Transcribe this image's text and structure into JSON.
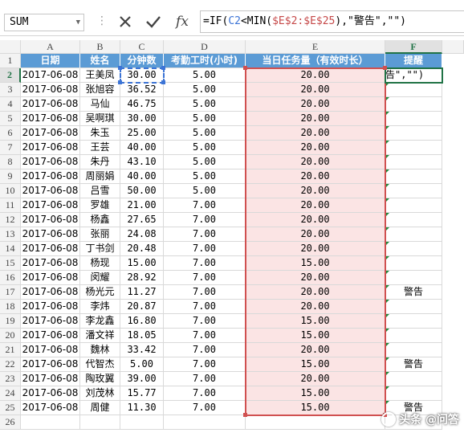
{
  "formula_bar": {
    "name_box": "SUM",
    "cancel_icon": "close-icon",
    "enter_icon": "check-icon",
    "function_icon": "fx-icon",
    "fx_label": "fx",
    "formula_parts": [
      "=IF(",
      "C2",
      "<MIN(",
      "$E$2:$E$25",
      "),\"警告\",\"\")"
    ]
  },
  "columns": [
    "A",
    "B",
    "C",
    "D",
    "E",
    "F"
  ],
  "selected_column": "F",
  "selected_row": 2,
  "headers": [
    "日期",
    "姓名",
    "分钟数",
    "考勤工时(小时)",
    "当日任务量（有效时长）",
    "提醒"
  ],
  "rows": [
    {
      "num": "2",
      "date": "2017-06-08",
      "name": "王美凤",
      "minutes": "30.00",
      "hours": "5.00",
      "task": "20.00",
      "alert": "告\",\"\")"
    },
    {
      "num": "3",
      "date": "2017-06-08",
      "name": "张旭容",
      "minutes": "36.52",
      "hours": "5.00",
      "task": "20.00",
      "alert": ""
    },
    {
      "num": "4",
      "date": "2017-06-08",
      "name": "马仙",
      "minutes": "46.75",
      "hours": "5.00",
      "task": "20.00",
      "alert": ""
    },
    {
      "num": "5",
      "date": "2017-06-08",
      "name": "吴啊琪",
      "minutes": "30.00",
      "hours": "5.00",
      "task": "20.00",
      "alert": ""
    },
    {
      "num": "6",
      "date": "2017-06-08",
      "name": "朱玉",
      "minutes": "25.00",
      "hours": "5.00",
      "task": "20.00",
      "alert": ""
    },
    {
      "num": "7",
      "date": "2017-06-08",
      "name": "王芸",
      "minutes": "40.00",
      "hours": "5.00",
      "task": "20.00",
      "alert": ""
    },
    {
      "num": "8",
      "date": "2017-06-08",
      "name": "朱丹",
      "minutes": "43.10",
      "hours": "5.00",
      "task": "20.00",
      "alert": ""
    },
    {
      "num": "9",
      "date": "2017-06-08",
      "name": "周丽娟",
      "minutes": "40.00",
      "hours": "5.00",
      "task": "20.00",
      "alert": ""
    },
    {
      "num": "10",
      "date": "2017-06-08",
      "name": "吕雪",
      "minutes": "50.00",
      "hours": "5.00",
      "task": "20.00",
      "alert": ""
    },
    {
      "num": "11",
      "date": "2017-06-08",
      "name": "罗雄",
      "minutes": "21.00",
      "hours": "7.00",
      "task": "20.00",
      "alert": ""
    },
    {
      "num": "12",
      "date": "2017-06-08",
      "name": "杨鑫",
      "minutes": "27.65",
      "hours": "7.00",
      "task": "20.00",
      "alert": ""
    },
    {
      "num": "13",
      "date": "2017-06-08",
      "name": "张丽",
      "minutes": "24.08",
      "hours": "7.00",
      "task": "20.00",
      "alert": ""
    },
    {
      "num": "14",
      "date": "2017-06-08",
      "name": "丁书剑",
      "minutes": "20.48",
      "hours": "7.00",
      "task": "20.00",
      "alert": ""
    },
    {
      "num": "15",
      "date": "2017-06-08",
      "name": "杨现",
      "minutes": "15.00",
      "hours": "7.00",
      "task": "15.00",
      "alert": ""
    },
    {
      "num": "16",
      "date": "2017-06-08",
      "name": "闵耀",
      "minutes": "28.92",
      "hours": "7.00",
      "task": "20.00",
      "alert": ""
    },
    {
      "num": "17",
      "date": "2017-06-08",
      "name": "杨光元",
      "minutes": "11.27",
      "hours": "7.00",
      "task": "20.00",
      "alert": "警告"
    },
    {
      "num": "18",
      "date": "2017-06-08",
      "name": "李炜",
      "minutes": "20.87",
      "hours": "7.00",
      "task": "20.00",
      "alert": ""
    },
    {
      "num": "19",
      "date": "2017-06-08",
      "name": "李龙鑫",
      "minutes": "16.80",
      "hours": "7.00",
      "task": "15.00",
      "alert": ""
    },
    {
      "num": "20",
      "date": "2017-06-08",
      "name": "潘文祥",
      "minutes": "18.05",
      "hours": "7.00",
      "task": "15.00",
      "alert": ""
    },
    {
      "num": "21",
      "date": "2017-06-08",
      "name": "魏林",
      "minutes": "33.42",
      "hours": "7.00",
      "task": "20.00",
      "alert": ""
    },
    {
      "num": "22",
      "date": "2017-06-08",
      "name": "代智杰",
      "minutes": "5.00",
      "hours": "7.00",
      "task": "15.00",
      "alert": "警告"
    },
    {
      "num": "23",
      "date": "2017-06-08",
      "name": "陶玫翼",
      "minutes": "39.00",
      "hours": "7.00",
      "task": "20.00",
      "alert": ""
    },
    {
      "num": "24",
      "date": "2017-06-08",
      "name": "刘茂林",
      "minutes": "15.77",
      "hours": "7.00",
      "task": "15.00",
      "alert": ""
    },
    {
      "num": "25",
      "date": "2017-06-08",
      "name": "周健",
      "minutes": "11.30",
      "hours": "7.00",
      "task": "15.00",
      "alert": "警告"
    }
  ],
  "colors": {
    "header_fill": "#5b9bd5",
    "task_fill": "#fbe4e4",
    "ref_c2": "#3c74d6",
    "ref_range": "#d05050",
    "active": "#217346"
  },
  "watermark": "头条 @问答"
}
